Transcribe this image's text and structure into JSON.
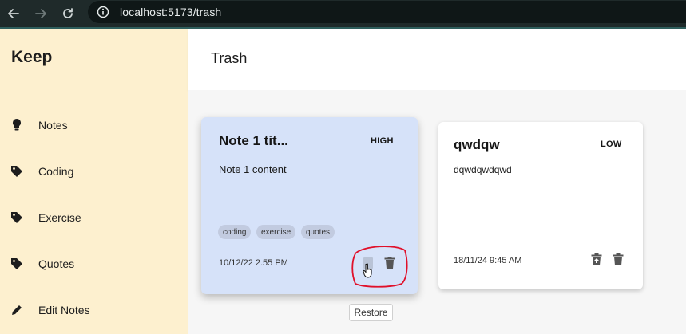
{
  "browser": {
    "url": "localhost:5173/trash"
  },
  "sidebar": {
    "logo": "Keep",
    "items": [
      {
        "label": "Notes",
        "icon": "lightbulb-icon"
      },
      {
        "label": "Coding",
        "icon": "tag-icon"
      },
      {
        "label": "Exercise",
        "icon": "tag-icon"
      },
      {
        "label": "Quotes",
        "icon": "tag-icon"
      },
      {
        "label": "Edit Notes",
        "icon": "pencil-icon"
      }
    ]
  },
  "header": {
    "title": "Trash"
  },
  "notes": [
    {
      "title": "Note 1 tit...",
      "priority": "HIGH",
      "content": "Note 1 content",
      "tags": [
        "coding",
        "exercise",
        "quotes"
      ],
      "date": "10/12/22 2.55 PM"
    },
    {
      "title": "qwdqw",
      "priority": "LOW",
      "content": "dqwdqwdqwd",
      "tags": [],
      "date": "18/11/24 9:45 AM"
    }
  ],
  "tooltip": {
    "text": "Restore"
  },
  "colors": {
    "sidebar_bg": "#fdf0cf",
    "selected_card_bg": "#d6e2f9",
    "highlight_stroke": "#e0102a"
  }
}
